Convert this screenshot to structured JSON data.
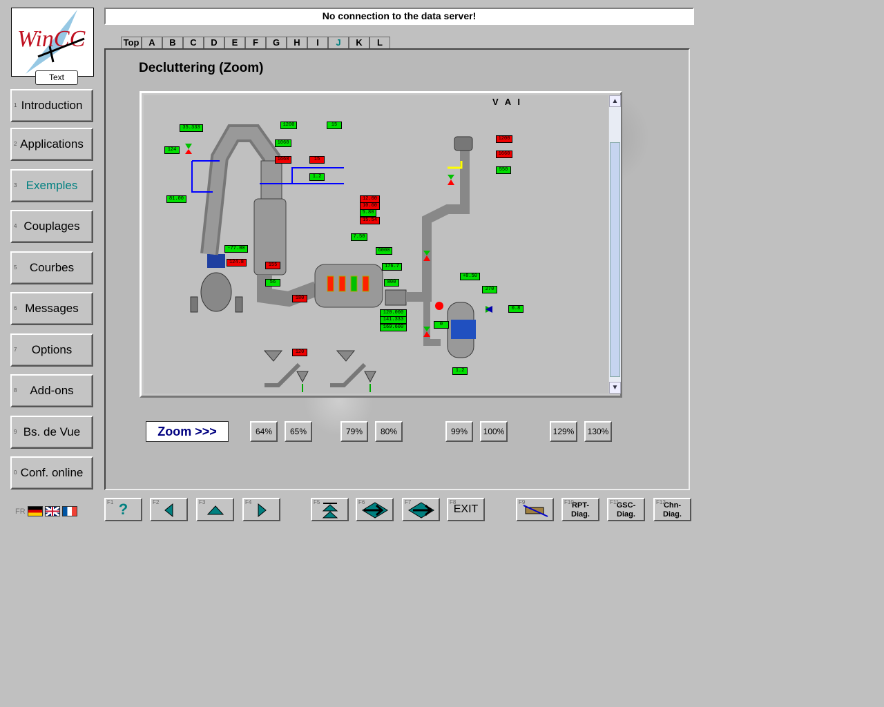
{
  "logo": {
    "brand": "WinCC",
    "text_button": "Text"
  },
  "status_message": "No connection to the data server!",
  "nav": [
    {
      "key": "1",
      "label": "Introduction"
    },
    {
      "key": "2",
      "label": "Applications"
    },
    {
      "key": "3",
      "label": "Exemples",
      "active": true
    },
    {
      "key": "4",
      "label": "Couplages"
    },
    {
      "key": "5",
      "label": "Courbes"
    },
    {
      "key": "6",
      "label": "Messages"
    },
    {
      "key": "7",
      "label": "Options"
    },
    {
      "key": "8",
      "label": "Add-ons"
    },
    {
      "key": "9",
      "label": "Bs. de Vue"
    },
    {
      "key": "0",
      "label": "Conf. online"
    }
  ],
  "tabs": [
    "Top",
    "A",
    "B",
    "C",
    "D",
    "E",
    "F",
    "G",
    "H",
    "I",
    "J",
    "K",
    "L"
  ],
  "page_title": "Decluttering (Zoom)",
  "diagram": {
    "brand": "V A I",
    "tags": [
      "35.333",
      "124",
      "1200",
      "15",
      "1060",
      "1668",
      "15",
      "1.2",
      "81.00",
      "12.00",
      "10.60",
      "5.80",
      "15.54",
      "7.50",
      "6000",
      "-77.00",
      "124.8",
      "155",
      "176.7",
      "800",
      "56",
      "180",
      "120.000",
      "141.333",
      "169.600",
      "1200",
      "1660",
      "550",
      "+8.50",
      "270",
      "0.8",
      "0",
      "120",
      "1.2"
    ]
  },
  "zoom": {
    "label": "Zoom >>>",
    "levels": [
      "64%",
      "65%",
      "79%",
      "80%",
      "99%",
      "100%",
      "129%",
      "130%"
    ]
  },
  "function_keys": [
    {
      "key": "F1",
      "icon": "help-icon",
      "label": "?"
    },
    {
      "key": "F2",
      "icon": "arrow-left-icon",
      "label": ""
    },
    {
      "key": "F3",
      "icon": "arrow-up-icon",
      "label": ""
    },
    {
      "key": "F4",
      "icon": "arrow-right-icon",
      "label": ""
    },
    {
      "key": "F5",
      "icon": "double-up-icon",
      "label": ""
    },
    {
      "key": "F6",
      "icon": "goto-arrow-icon",
      "label": ""
    },
    {
      "key": "F7",
      "icon": "goto-back-arrow-icon",
      "label": ""
    },
    {
      "key": "F8",
      "icon": "exit-icon",
      "label": "EXIT"
    },
    {
      "key": "F9",
      "icon": "disabled-icon",
      "label": ""
    },
    {
      "key": "F10",
      "icon": "",
      "label": "RPT-\nDiag."
    },
    {
      "key": "F11",
      "icon": "",
      "label": "GSC-\nDiag."
    },
    {
      "key": "F12",
      "icon": "",
      "label": "Chn-\nDiag."
    }
  ],
  "language": {
    "current": "FR"
  },
  "colors": {
    "accent": "#008080",
    "alarm": "#f00000",
    "ok": "#00e000"
  }
}
